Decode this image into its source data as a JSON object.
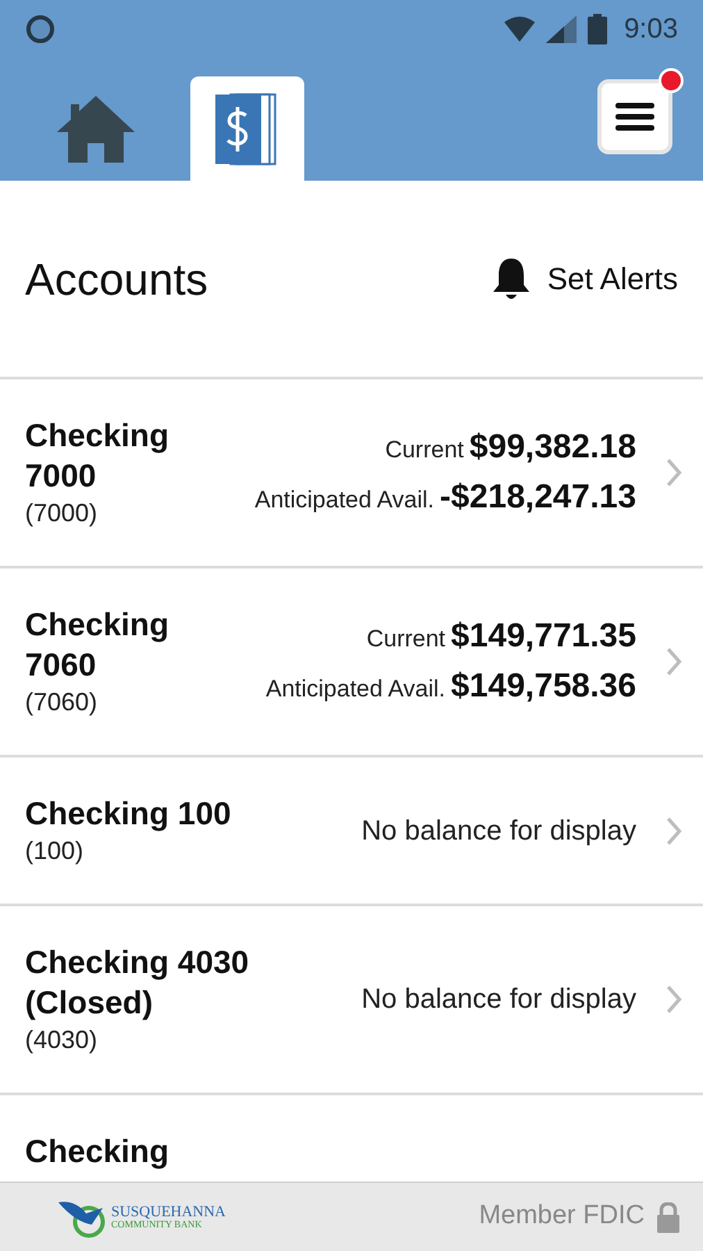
{
  "status_bar": {
    "time": "9:03"
  },
  "nav_tabs": [
    {
      "kind": "home",
      "selected": false
    },
    {
      "kind": "accounts",
      "selected": true
    }
  ],
  "menu": {
    "notification": true
  },
  "page": {
    "title": "Accounts",
    "alerts_action": "Set Alerts"
  },
  "accounts": [
    {
      "kind": "balances",
      "name": "Checking 7000",
      "number": "(7000)",
      "current_label": "Current",
      "current": "$99,382.18",
      "avail_label": "Anticipated Avail.",
      "avail": "-$218,247.13"
    },
    {
      "kind": "balances",
      "name": "Checking 7060",
      "number": "(7060)",
      "current_label": "Current",
      "current": "$149,771.35",
      "avail_label": "Anticipated Avail.",
      "avail": "$149,758.36"
    },
    {
      "kind": "none",
      "name": "Checking 100",
      "number": "(100)",
      "message": "No balance for display"
    },
    {
      "kind": "none",
      "name": "Checking 4030 (Closed)",
      "number": "(4030)",
      "message": "No balance for display"
    },
    {
      "kind": "partial",
      "name": "Checking"
    }
  ],
  "footer": {
    "logo_name": "SUSQUEHANNA",
    "logo_sub": "COMMUNITY BANK",
    "member": "Member FDIC"
  }
}
